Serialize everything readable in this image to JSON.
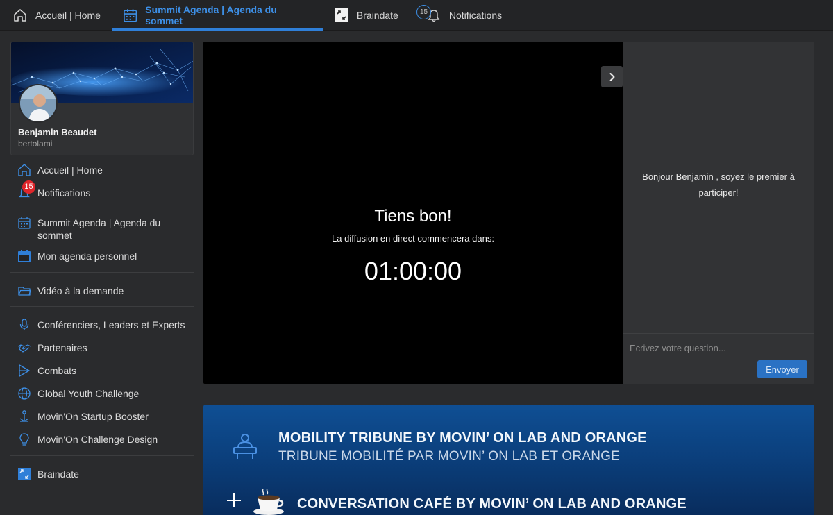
{
  "topnav": {
    "home_label": "Accueil | Home",
    "agenda_label": "Summit Agenda | Agenda du sommet",
    "braindate_label": "Braindate",
    "notifications_label": "Notifications",
    "notifications_count": "15",
    "accent_color": "#2f7fd8"
  },
  "profile": {
    "name": "Benjamin Beaudet",
    "handle": "bertolami"
  },
  "sidebar": {
    "items": [
      {
        "label": "Accueil | Home",
        "icon": "home-icon"
      },
      {
        "label": "Notifications",
        "icon": "bell-icon",
        "badge": "15"
      },
      {
        "label": "Summit Agenda | Agenda du sommet",
        "icon": "calendar-icon"
      },
      {
        "label": "Mon agenda personnel",
        "icon": "calendar-filled-icon"
      },
      {
        "label": "Vidéo à la demande",
        "icon": "folder-icon"
      },
      {
        "label": "Conférenciers, Leaders et Experts",
        "icon": "microphone-icon"
      },
      {
        "label": "Partenaires",
        "icon": "handshake-icon"
      },
      {
        "label": "Combats",
        "icon": "play-icon"
      },
      {
        "label": "Global Youth Challenge",
        "icon": "globe-icon"
      },
      {
        "label": "Movin'On Startup Booster",
        "icon": "booster-icon"
      },
      {
        "label": "Movin'On Challenge Design",
        "icon": "lightbulb-icon"
      },
      {
        "label": "Braindate",
        "icon": "braindate-icon"
      }
    ]
  },
  "video": {
    "title": "Tiens bon!",
    "subtitle": "La diffusion en direct commencera dans:",
    "countdown": "01:00:00"
  },
  "chat": {
    "welcome": "Bonjour Benjamin , soyez le premier à participer!",
    "input_placeholder": "Ecrivez votre question...",
    "send_label": "Envoyer",
    "send_color": "#2a72c4"
  },
  "sessions": [
    {
      "title": "MOBILITY TRIBUNE BY MOVIN’ ON LAB AND ORANGE",
      "subtitle": "TRIBUNE MOBILITÉ PAR MOVIN’ ON LAB ET ORANGE"
    },
    {
      "title": "CONVERSATION CAFÉ BY MOVIN’ ON LAB AND ORANGE"
    }
  ]
}
